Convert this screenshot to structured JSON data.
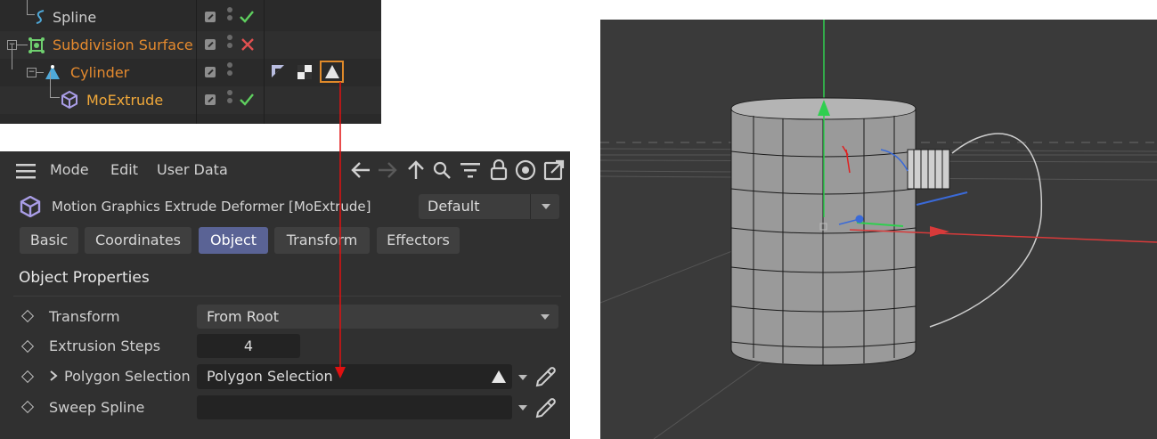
{
  "object_manager": {
    "rows": [
      {
        "name": "Spline",
        "color": "#cfcfcf",
        "status": "check"
      },
      {
        "name": "Subdivision Surface",
        "color": "#e58a2e",
        "status": "cross"
      },
      {
        "name": "Cylinder",
        "color": "#e58a2e",
        "status": "none"
      },
      {
        "name": "MoExtrude",
        "color": "#f0a83a",
        "status": "check"
      }
    ]
  },
  "attribute_manager": {
    "menu": [
      "Mode",
      "Edit",
      "User Data"
    ],
    "title": "Motion Graphics Extrude Deformer [MoExtrude]",
    "preset": "Default",
    "tabs": [
      "Basic",
      "Coordinates",
      "Object",
      "Transform",
      "Effectors"
    ],
    "active_tab": "Object",
    "section_title": "Object Properties",
    "properties": [
      {
        "label": "Transform",
        "value": "From Root"
      },
      {
        "label": "Extrusion Steps",
        "value": "4"
      },
      {
        "label": "Polygon Selection",
        "value": "Polygon Selection"
      },
      {
        "label": "Sweep Spline",
        "value": ""
      }
    ]
  },
  "colors": {
    "accent": "#5a6395",
    "check": "#5fcf5f",
    "cross": "#e05050",
    "selection_box": "#e08a2a",
    "arrow": "#e01010"
  }
}
